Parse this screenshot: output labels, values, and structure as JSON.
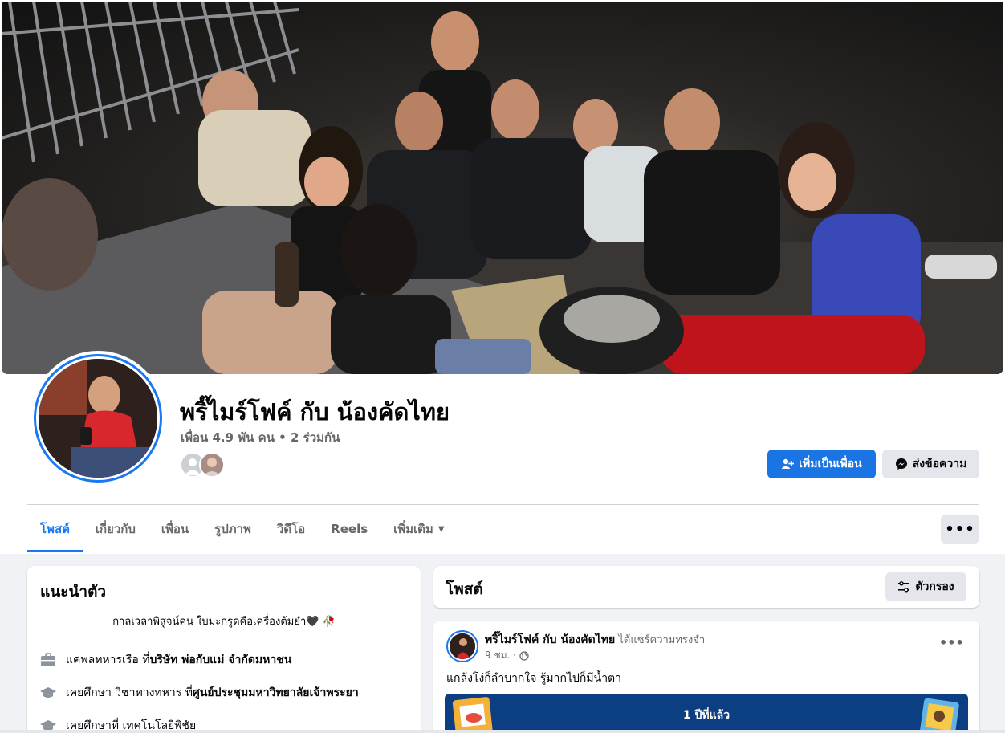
{
  "profile": {
    "name": "พริ๊ไมร์โฟค์ กับ น้องคัดไทย",
    "meta": "เพื่อน 4.9 พัน คน • 2 ร่วมกัน"
  },
  "actions": {
    "add_friend": "เพิ่มเป็นเพื่อน",
    "message": "ส่งข้อความ"
  },
  "tabs": [
    {
      "label": "โพสต์",
      "active": true
    },
    {
      "label": "เกี่ยวกับ",
      "active": false
    },
    {
      "label": "เพื่อน",
      "active": false
    },
    {
      "label": "รูปภาพ",
      "active": false
    },
    {
      "label": "วิดีโอ",
      "active": false
    },
    {
      "label": "Reels",
      "active": false
    },
    {
      "label": "เพิ่มเติม",
      "active": false
    }
  ],
  "more_label": "•••",
  "intro": {
    "title": "แนะนำตัว",
    "bio": "กาลเวลาพิสูจน์คน ใบมะกรูดคือเครื่องต้มยำ🖤 🥀",
    "work": {
      "prefix": "แคพลทหารเรือ ที่ ",
      "bold": "บริษัท พ่อกับแม่ จำกัดมหาชน"
    },
    "education1": {
      "prefix": "เคยศึกษา วิชาทางทหาร ที่ ",
      "bold": "ศูนย์ประชุมมหาวิทยาลัยเจ้าพระยา"
    },
    "education2": {
      "prefix": "เคยศึกษาที่ เทคโนโลยีพิชัย",
      "bold": ""
    }
  },
  "posts": {
    "title": "โพสต์",
    "filter_label": "ตัวกรอง"
  },
  "post": {
    "author": "พริ๊ไมร์โฟค์ กับ น้องคัดไทย",
    "action": " ได้แชร์ความทรงจำ",
    "time": "9 ชม. ·",
    "menu": "•••",
    "text": "แกล้งโง่ก็ลำบากใจ  รู้มากไปก็มีน้ำตา",
    "memory_title": "1 ปีที่แล้ว"
  },
  "colors": {
    "accent": "#1877f2",
    "button_primary": "#1b74e4",
    "button_secondary": "#e4e6eb",
    "memory_banner": "#0b3f82"
  },
  "icons": [
    "add-friend-icon",
    "messenger-icon",
    "caret-down-icon",
    "briefcase-icon",
    "graduation-cap-icon",
    "filter-icon",
    "globe-icon"
  ]
}
